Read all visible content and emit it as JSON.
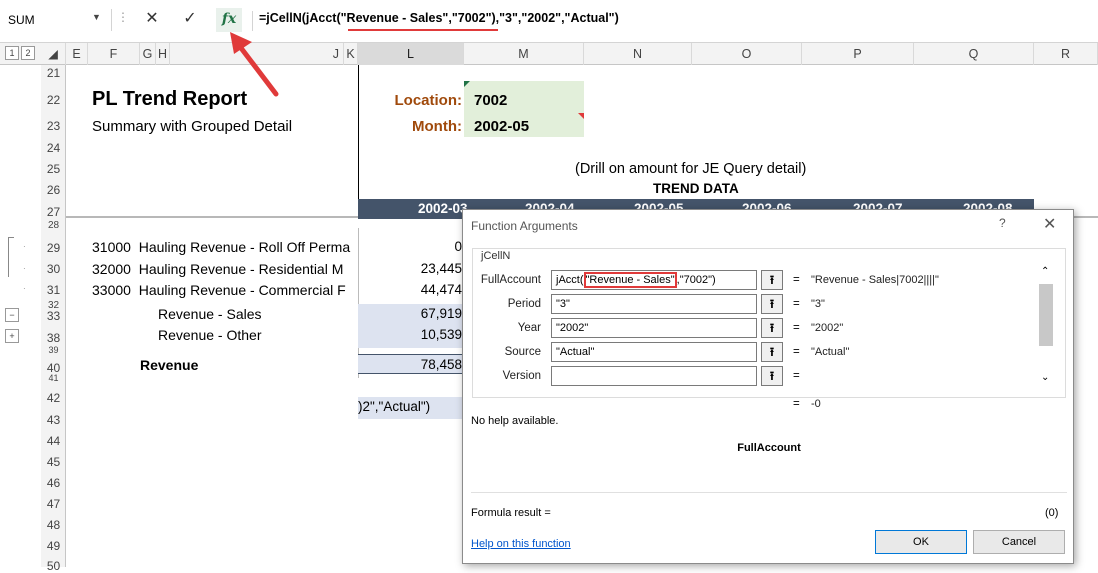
{
  "formula_bar": {
    "name_box": "SUM",
    "cancel_glyph": "✕",
    "enter_glyph": "✓",
    "fx_label": "fx",
    "formula_part1": "=jCellN(jAcct(",
    "formula_part2": "\"Revenue - Sales\"",
    "formula_part3": ",\"7002\"),\"3\",\"2002\",\"Actual\")"
  },
  "outline_levels": [
    "1",
    "2"
  ],
  "columns": [
    "E",
    "F",
    "G",
    "H",
    "J",
    "K",
    "L",
    "M",
    "N",
    "O",
    "P",
    "Q",
    "R"
  ],
  "rows": [
    "21",
    "22",
    "23",
    "24",
    "25",
    "26",
    "27",
    "28",
    "29",
    "30",
    "31",
    "32",
    "33",
    "38",
    "39",
    "40",
    "41",
    "42",
    "43",
    "44",
    "45",
    "46",
    "47",
    "48",
    "49",
    "50"
  ],
  "group_buttons": [
    "−",
    "+"
  ],
  "report": {
    "title": "PL Trend Report",
    "subtitle": "Summary with Grouped Detail",
    "location_label": "Location:",
    "location_value": "7002",
    "month_label": "Month:",
    "month_value": "2002-05",
    "drill_note": "(Drill on amount for JE Query detail)",
    "trend_heading": "TREND DATA",
    "trend_months": [
      "2002-03",
      "2002-04",
      "2002-05",
      "2002-06",
      "2002-07",
      "2002-08"
    ]
  },
  "accounts": [
    {
      "code": "31000",
      "name": "Hauling Revenue - Roll Off Perma",
      "value": "0"
    },
    {
      "code": "32000",
      "name": "Hauling Revenue - Residential M",
      "value": "23,445"
    },
    {
      "code": "33000",
      "name": "Hauling Revenue - Commercial F",
      "value": "44,474"
    }
  ],
  "summaries": [
    {
      "name": "Revenue - Sales",
      "value": "67,919"
    },
    {
      "name": "Revenue - Other",
      "value": "10,539"
    }
  ],
  "total": {
    "name": "Revenue",
    "value": "78,458"
  },
  "cell_overflow": ")2\",\"Actual\")",
  "dialog": {
    "title": "Function Arguments",
    "help_glyph": "?",
    "close_glyph": "✕",
    "function_name": "jCellN",
    "args": [
      {
        "label": "FullAccount",
        "value_prefix": "jAcct(",
        "value_highlight": "\"Revenue - Sales\"",
        "value_suffix": ",\"7002\")",
        "result": "\"Revenue - Sales|7002||||\""
      },
      {
        "label": "Period",
        "value": "\"3\"",
        "result": "\"3\""
      },
      {
        "label": "Year",
        "value": "\"2002\"",
        "result": "\"2002\""
      },
      {
        "label": "Source",
        "value": "\"Actual\"",
        "result": "\"Actual\""
      },
      {
        "label": "Version",
        "value": "",
        "result": ""
      }
    ],
    "ref_glyph": "⭱",
    "equals": "=",
    "function_result": "-0",
    "no_help": "No help available.",
    "arg_description_name": "FullAccount",
    "formula_result_label": "Formula result =",
    "formula_result_value": "(0)",
    "help_link": "Help on this function",
    "ok_label": "OK",
    "cancel_label": "Cancel"
  },
  "colors": {
    "excel_green": "#217346",
    "annotation_red": "#e03a3a",
    "label_orange": "#a04a0c",
    "header_band": "#44546a",
    "input_green": "#e2efda"
  }
}
